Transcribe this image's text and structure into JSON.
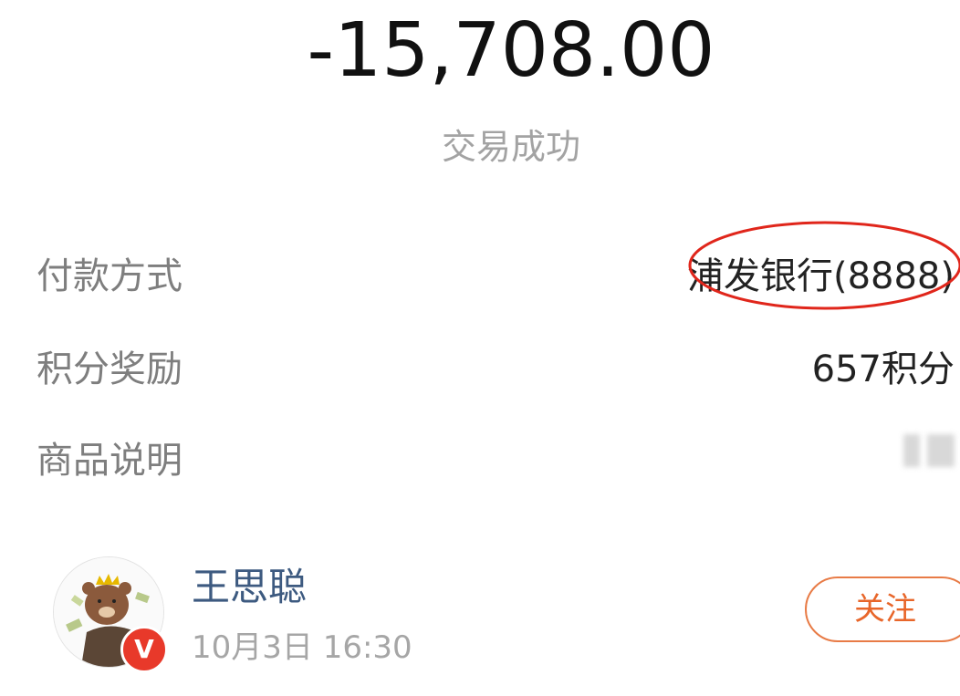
{
  "transaction": {
    "amount": "-15,708.00",
    "status": "交易成功"
  },
  "details": {
    "payment_method_label": "付款方式",
    "payment_method_value": "浦发银行(8888)",
    "points_label": "积分奖励",
    "points_value": "657积分",
    "description_label": "商品说明"
  },
  "user": {
    "name": "王思聪",
    "time": "10月3日  16:30",
    "badge": "V",
    "follow_label": "关注"
  },
  "colors": {
    "annotation_ellipse": "#e0261b",
    "follow_accent": "#e8662a",
    "verified_badge": "#e8392a",
    "username": "#3d5a80"
  }
}
